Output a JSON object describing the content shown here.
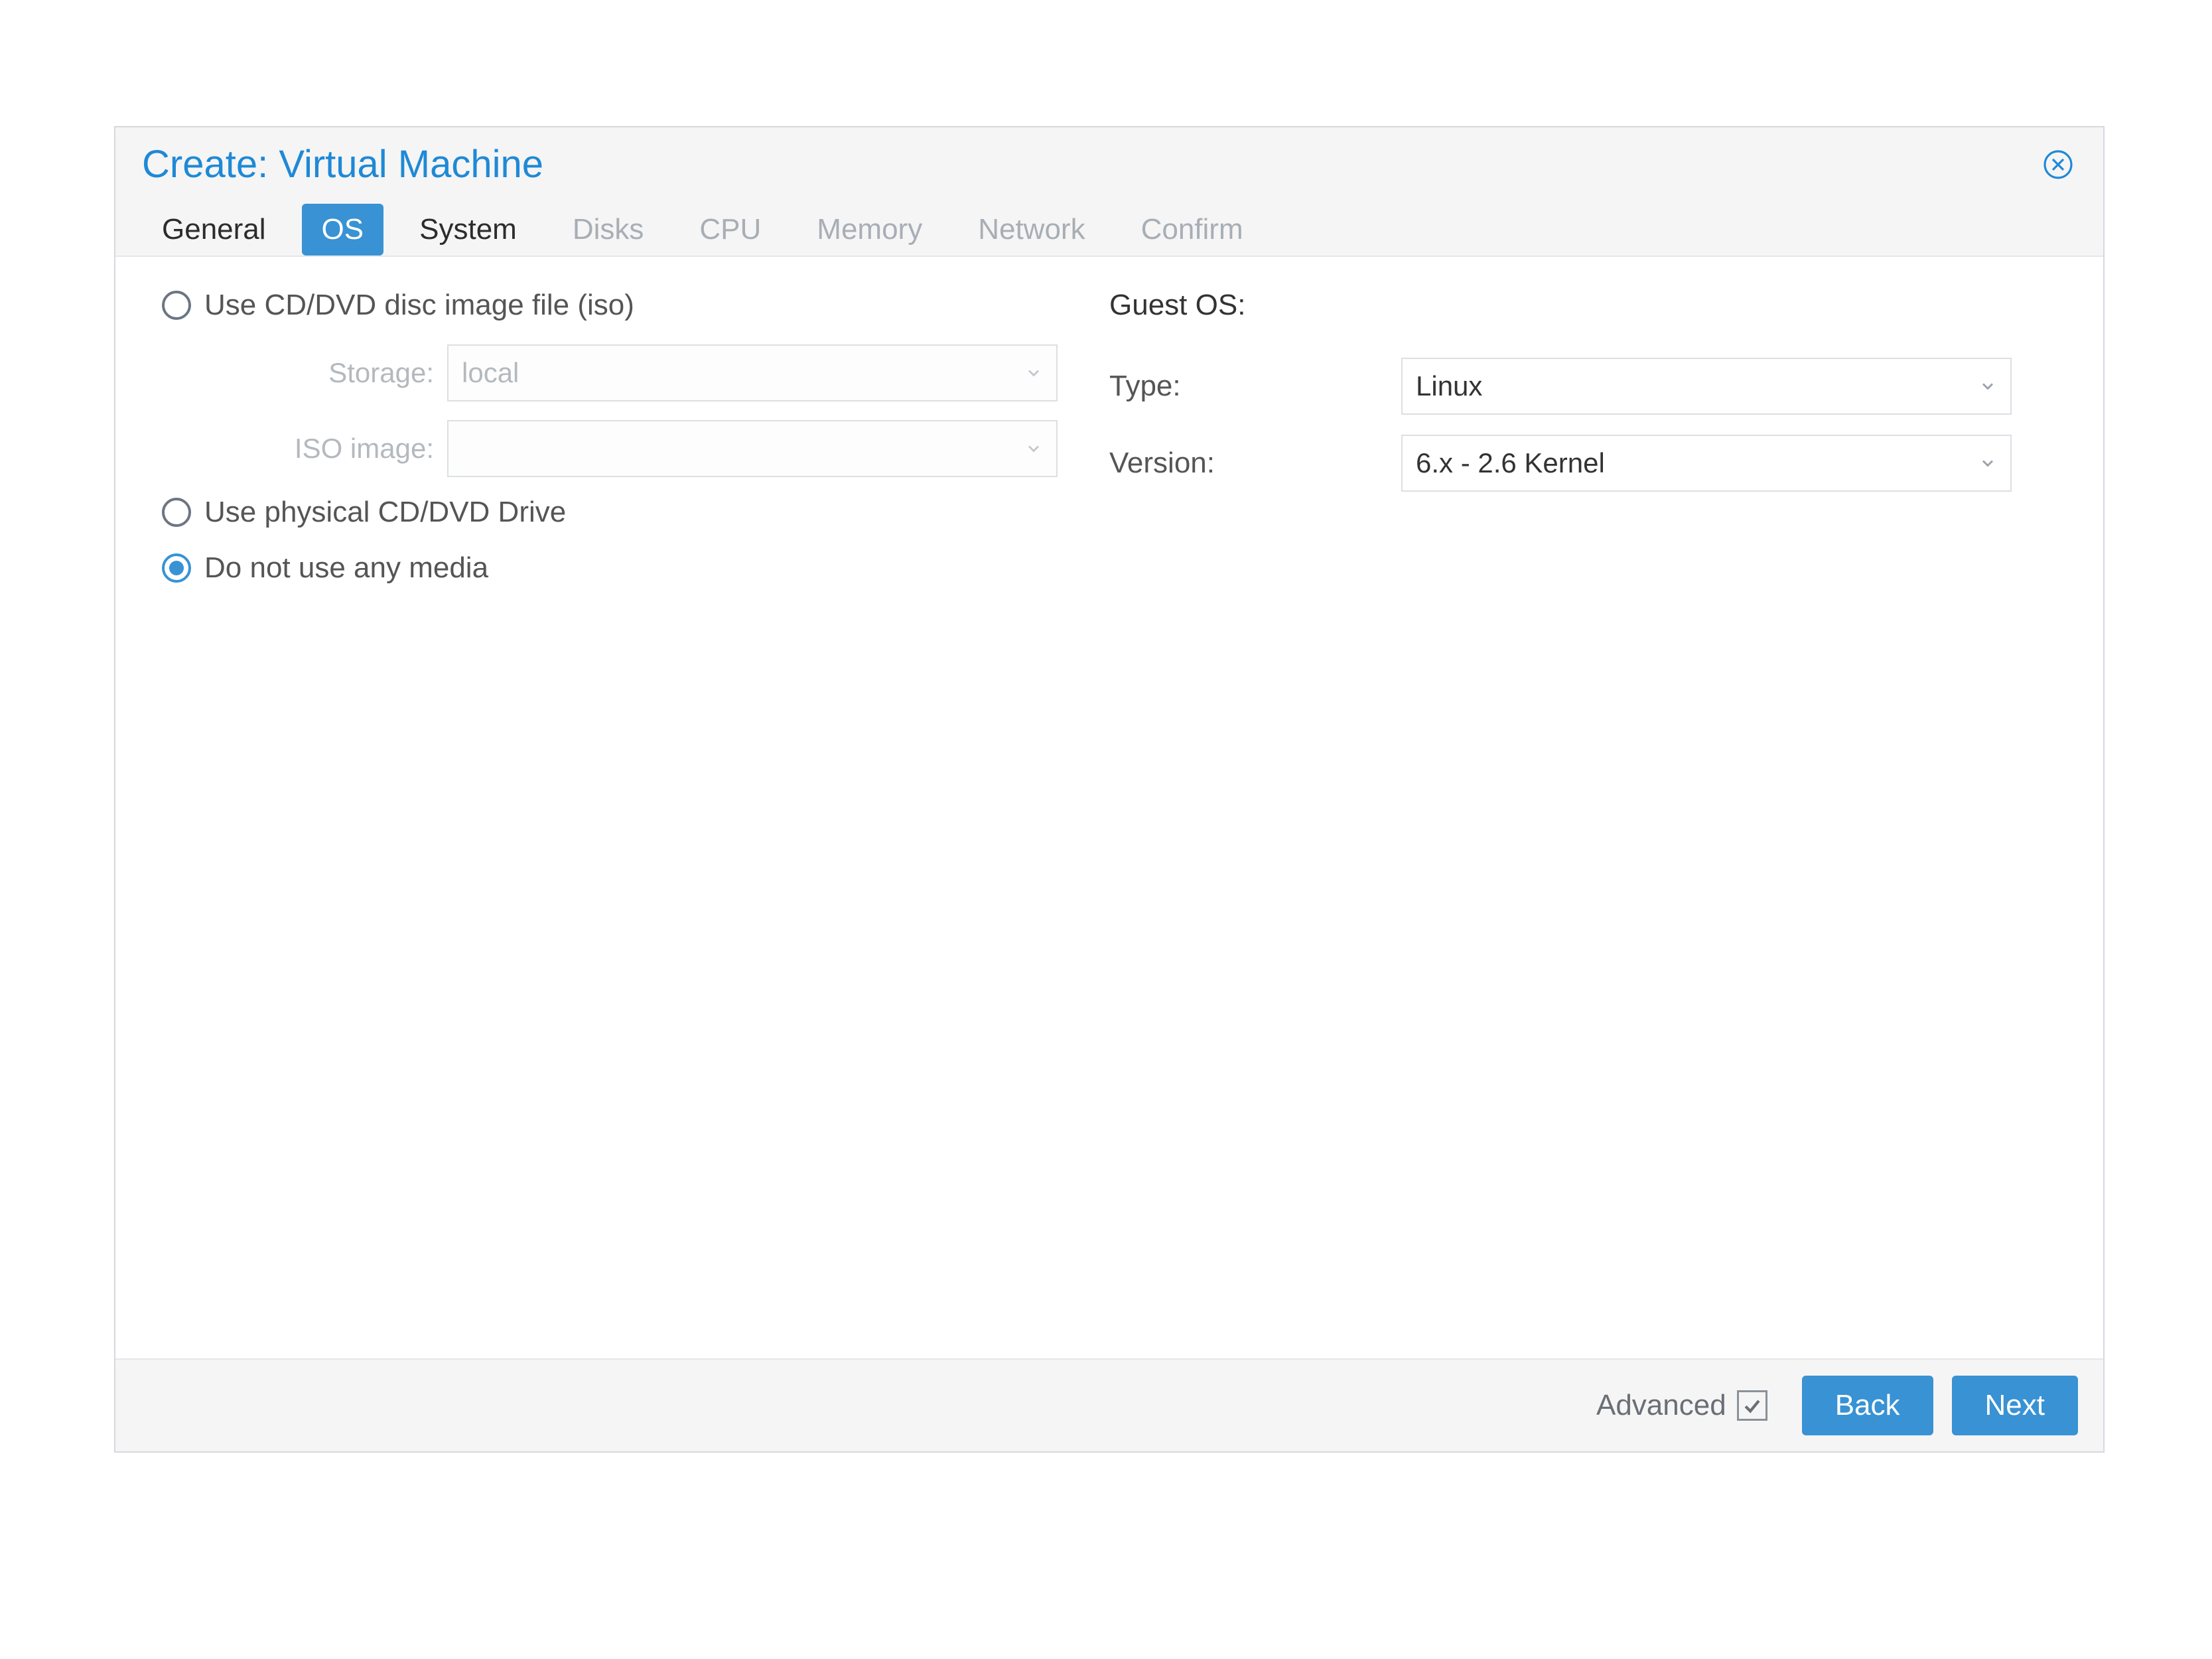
{
  "modal": {
    "title": "Create: Virtual Machine"
  },
  "tabs": [
    {
      "label": "General",
      "state": "enabled"
    },
    {
      "label": "OS",
      "state": "active"
    },
    {
      "label": "System",
      "state": "enabled"
    },
    {
      "label": "Disks",
      "state": "disabled"
    },
    {
      "label": "CPU",
      "state": "disabled"
    },
    {
      "label": "Memory",
      "state": "disabled"
    },
    {
      "label": "Network",
      "state": "disabled"
    },
    {
      "label": "Confirm",
      "state": "disabled"
    }
  ],
  "media": {
    "option_iso": "Use CD/DVD disc image file (iso)",
    "option_physical": "Use physical CD/DVD Drive",
    "option_none": "Do not use any media",
    "selected": "none",
    "storage_label": "Storage:",
    "storage_value": "local",
    "iso_label": "ISO image:",
    "iso_value": ""
  },
  "guest": {
    "heading": "Guest OS:",
    "type_label": "Type:",
    "type_value": "Linux",
    "version_label": "Version:",
    "version_value": "6.x - 2.6 Kernel"
  },
  "footer": {
    "advanced_label": "Advanced",
    "advanced_checked": true,
    "back": "Back",
    "next": "Next"
  }
}
